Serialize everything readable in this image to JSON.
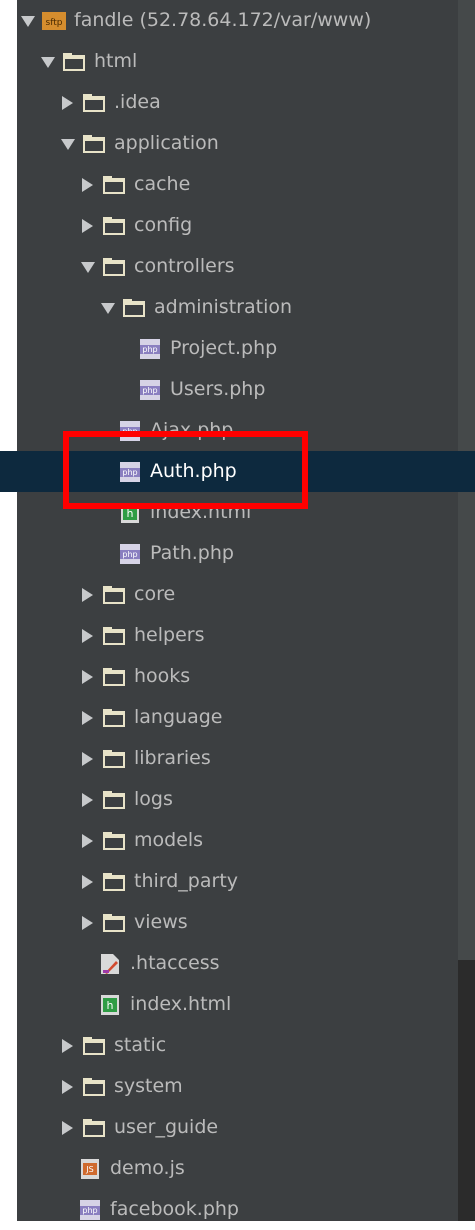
{
  "project_tree": {
    "root": {
      "label": "fandle (52.78.64.172/var/www)",
      "icon": "sftp-icon",
      "expanded": true
    },
    "items": [
      {
        "label": "html",
        "icon": "folder-icon",
        "expanded": true
      },
      {
        "label": ".idea",
        "icon": "folder-icon",
        "expanded": false
      },
      {
        "label": "application",
        "icon": "folder-icon",
        "expanded": true
      },
      {
        "label": "cache",
        "icon": "folder-icon",
        "expanded": false
      },
      {
        "label": "config",
        "icon": "folder-icon",
        "expanded": false
      },
      {
        "label": "controllers",
        "icon": "folder-icon",
        "expanded": true
      },
      {
        "label": "administration",
        "icon": "folder-icon",
        "expanded": true
      },
      {
        "label": "Project.php",
        "icon": "php-file-icon"
      },
      {
        "label": "Users.php",
        "icon": "php-file-icon"
      },
      {
        "label": "Ajax.php",
        "icon": "php-file-icon"
      },
      {
        "label": "Auth.php",
        "icon": "php-file-icon",
        "selected": true
      },
      {
        "label": "index.html",
        "icon": "html-file-icon"
      },
      {
        "label": "Path.php",
        "icon": "php-file-icon"
      },
      {
        "label": "core",
        "icon": "folder-icon",
        "expanded": false
      },
      {
        "label": "helpers",
        "icon": "folder-icon",
        "expanded": false
      },
      {
        "label": "hooks",
        "icon": "folder-icon",
        "expanded": false
      },
      {
        "label": "language",
        "icon": "folder-icon",
        "expanded": false
      },
      {
        "label": "libraries",
        "icon": "folder-icon",
        "expanded": false
      },
      {
        "label": "logs",
        "icon": "folder-icon",
        "expanded": false
      },
      {
        "label": "models",
        "icon": "folder-icon",
        "expanded": false
      },
      {
        "label": "third_party",
        "icon": "folder-icon",
        "expanded": false
      },
      {
        "label": "views",
        "icon": "folder-icon",
        "expanded": false
      },
      {
        "label": ".htaccess",
        "icon": "htaccess-file-icon"
      },
      {
        "label": "index.html",
        "icon": "html-file-icon"
      },
      {
        "label": "static",
        "icon": "folder-icon",
        "expanded": false
      },
      {
        "label": "system",
        "icon": "folder-icon",
        "expanded": false
      },
      {
        "label": "user_guide",
        "icon": "folder-icon",
        "expanded": false
      },
      {
        "label": "demo.js",
        "icon": "js-file-icon"
      },
      {
        "label": "facebook.php",
        "icon": "php-file-icon"
      }
    ]
  },
  "icon_text": {
    "sftp": "sftp",
    "php": "php",
    "js": "JS",
    "html": "h"
  },
  "colors": {
    "panel": "#3c3f41",
    "selection": "#0d293e",
    "text": "#bbbbbb",
    "folder": "#e8e3c8",
    "highlight_box": "#ff0000"
  }
}
